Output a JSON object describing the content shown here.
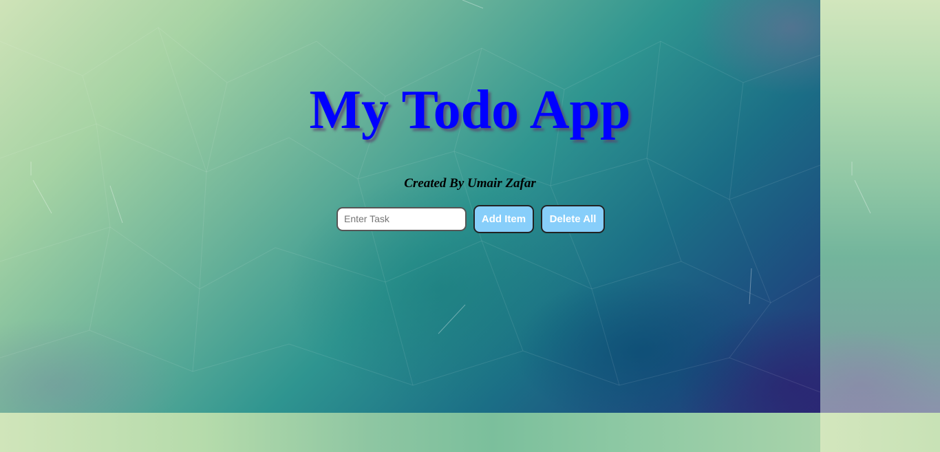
{
  "header": {
    "title": "My Todo App",
    "subtitle": "Created By Umair Zafar"
  },
  "form": {
    "input_placeholder": "Enter Task",
    "input_value": "",
    "add_label": "Add Item",
    "delete_all_label": "Delete All"
  },
  "colors": {
    "title": "#0000ff",
    "button_background": "#87cefa",
    "button_text": "#ffffff"
  }
}
